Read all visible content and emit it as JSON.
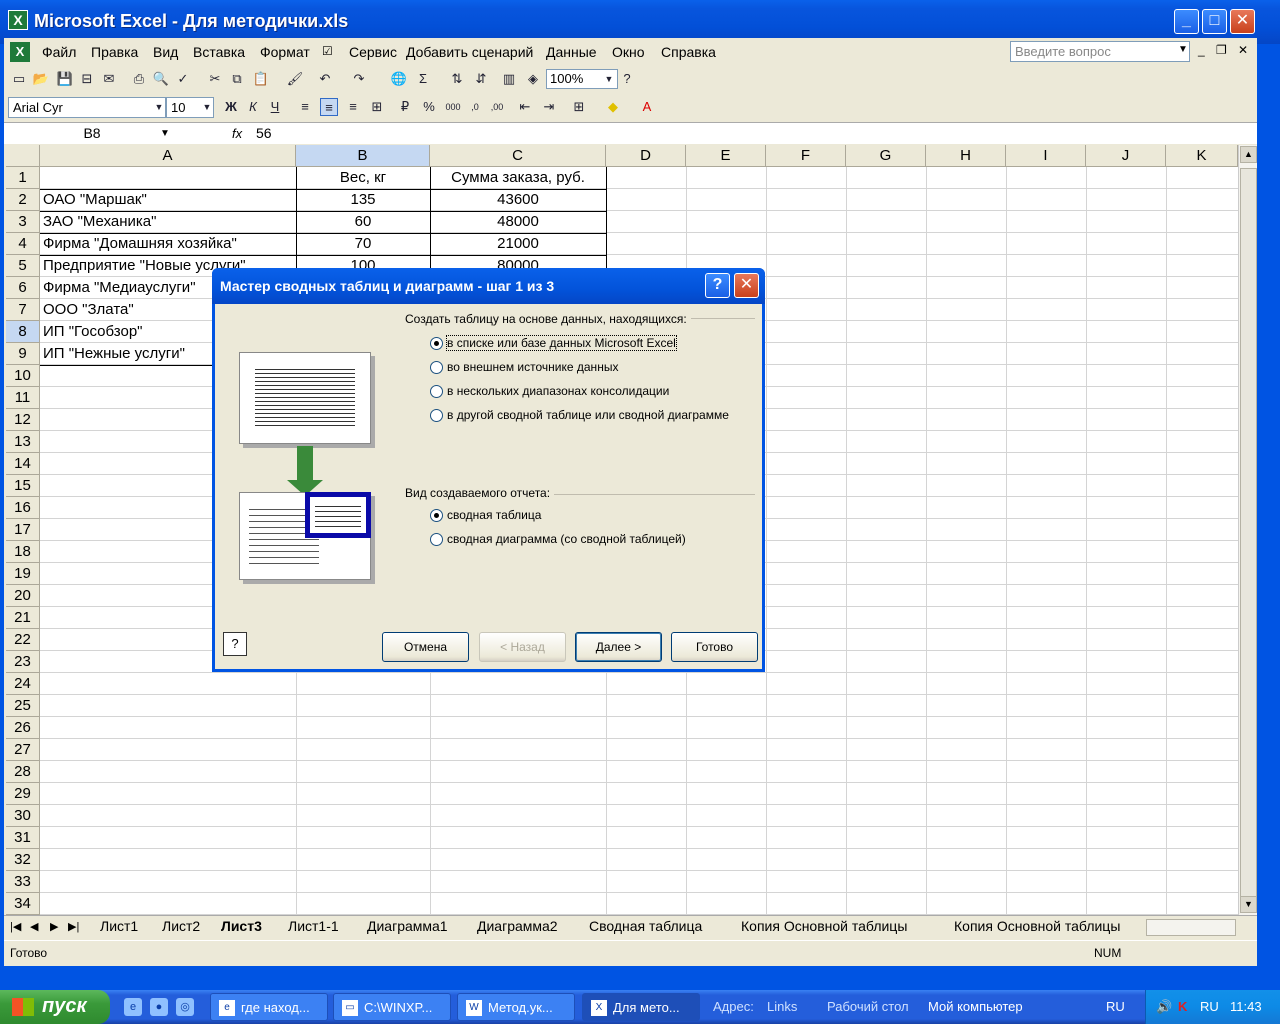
{
  "window": {
    "title": "Microsoft Excel - Для методички.xls"
  },
  "menu": [
    "Файл",
    "Правка",
    "Вид",
    "Вставка",
    "Формат",
    "Сервис",
    "Добавить сценарий",
    "Данные",
    "Окно",
    "Справка"
  ],
  "ask_placeholder": "Введите вопрос",
  "toolbar": {
    "zoom": "100%",
    "font_name": "Arial Cyr",
    "font_size": "10",
    "bold": "Ж",
    "italic": "К",
    "underline": "Ч"
  },
  "formula": {
    "cell_ref": "B8",
    "fx": "fx",
    "value": "56"
  },
  "columns": [
    "A",
    "B",
    "C",
    "D",
    "E",
    "F",
    "G",
    "H",
    "I",
    "J",
    "K"
  ],
  "rows": [
    "1",
    "2",
    "3",
    "4",
    "5",
    "6",
    "7",
    "8",
    "9",
    "10",
    "11",
    "12",
    "13",
    "14",
    "15",
    "16",
    "17",
    "18",
    "19",
    "20",
    "21",
    "22",
    "23",
    "24",
    "25",
    "26",
    "27",
    "28",
    "29",
    "30",
    "31",
    "32",
    "33",
    "34"
  ],
  "table": {
    "header_b": "Вес, кг",
    "header_c": "Сумма заказа, руб.",
    "data": [
      {
        "a": "ОАО \"Маршак\"",
        "b": "135",
        "c": "43600"
      },
      {
        "a": "ЗАО \"Механика\"",
        "b": "60",
        "c": "48000"
      },
      {
        "a": "Фирма \"Домашняя хозяйка\"",
        "b": "70",
        "c": "21000"
      },
      {
        "a": "Предприятие \"Новые услуги\"",
        "b": "100",
        "c": "80000"
      },
      {
        "a": "Фирма \"Медиауслуги\"",
        "b": "",
        "c": ""
      },
      {
        "a": "ООО \"Злата\"",
        "b": "",
        "c": ""
      },
      {
        "a": "ИП \"Гособзор\"",
        "b": "",
        "c": ""
      },
      {
        "a": "ИП \"Нежные услуги\"",
        "b": "",
        "c": ""
      }
    ]
  },
  "sheet_tabs": [
    "Лист1",
    "Лист2",
    "Лист3",
    "Лист1-1",
    "Диаграмма1",
    "Диаграмма2",
    "Сводная таблица",
    "Копия Основной таблицы",
    "Копия Основной таблицы"
  ],
  "active_tab": "Лист3",
  "status": {
    "text": "Готово",
    "num": "NUM"
  },
  "dialog": {
    "title": "Мастер сводных таблиц и диаграмм - шаг 1 из 3",
    "source_group": "Создать таблицу на основе данных, находящихся:",
    "source_options": [
      "в списке или базе данных Microsoft Excel",
      "во внешнем источнике данных",
      "в нескольких диапазонах консолидации",
      "в другой сводной таблице или сводной диаграмме"
    ],
    "report_group": "Вид создаваемого отчета:",
    "report_options": [
      "сводная таблица",
      "сводная диаграмма (со сводной таблицей)"
    ],
    "buttons": {
      "cancel": "Отмена",
      "back": "< Назад",
      "next": "Далее >",
      "finish": "Готово"
    }
  },
  "taskbar": {
    "start": "пуск",
    "tasks": [
      "где наход...",
      "C:\\WINXP...",
      "Метод.ук...",
      "Для мето..."
    ],
    "address_label": "Адрес:",
    "links": "Links",
    "desktop": "Рабочий стол",
    "my_computer": "Мой компьютер",
    "lang": "RU",
    "tray_lang": "RU",
    "clock": "11:43"
  }
}
